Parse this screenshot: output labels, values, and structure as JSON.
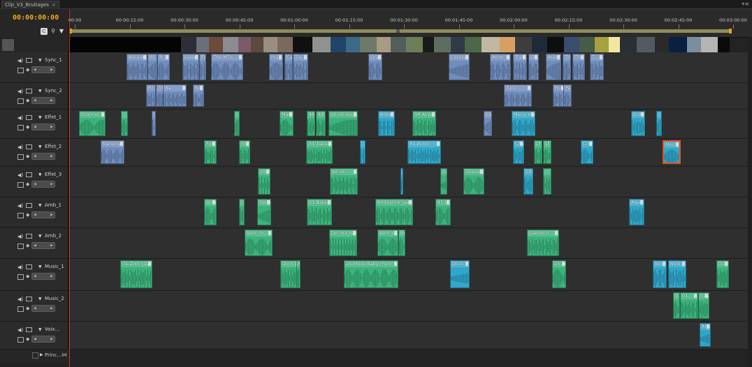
{
  "tab": {
    "title": "Clip_V3_Bruitages",
    "close": "×"
  },
  "panel_menu": "▾≡",
  "timecode": "00:00:00:00",
  "ruler": {
    "labels": [
      "00:00",
      "00:00:15:00",
      "00:00:30:00",
      "00:00:45:00",
      "00:01:00:00",
      "00:01:15:00",
      "00:01:30:00",
      "00:01:45:00",
      "00:02:00:00",
      "00:02:15:00",
      "00:02:30:00",
      "00:02:45:00",
      "00:03:00:00"
    ]
  },
  "header_icons": {
    "snap": "⊂",
    "marker": "⚲",
    "link": "▼"
  },
  "track_controls": {
    "speaker": "◀)",
    "keyframe": "◆",
    "nav_prev": "◀",
    "nav_next": "▶"
  },
  "tracks": [
    {
      "name": "Sync_1",
      "clips": [
        {
          "n": "Ascenceu",
          "c": "blue"
        },
        {
          "n": "Ri",
          "c": "blue"
        },
        {
          "n": "R",
          "c": "blue"
        },
        {
          "n": "calech",
          "c": "blue"
        },
        {
          "n": "Fe",
          "c": "blue"
        },
        {
          "n": "The.MTS",
          "c": "blue"
        },
        {
          "n": "man",
          "c": "blue"
        },
        {
          "n": "Car_p",
          "c": "blue"
        },
        {
          "n": "Tra",
          "c": "blue"
        },
        {
          "n": "Grande",
          "c": "blue"
        },
        {
          "n": "Cuisine_I",
          "c": "blue"
        },
        {
          "n": "Anim_b",
          "c": "blue"
        },
        {
          "n": "Travau",
          "c": "blue"
        },
        {
          "n": "Oi",
          "c": "blue"
        },
        {
          "n": "Arenes",
          "c": "blue"
        },
        {
          "n": "The_en",
          "c": "blue"
        },
        {
          "n": "The",
          "c": "blue"
        },
        {
          "n": "T",
          "c": "blue"
        }
      ]
    },
    {
      "name": "Sync_2",
      "clips": [
        {
          "n": "Ri",
          "c": "blue"
        },
        {
          "n": "Tiffan",
          "c": "blue"
        },
        {
          "n": "Ba",
          "c": "blue"
        },
        {
          "n": "Noria.MPC",
          "c": "blue"
        },
        {
          "n": "Tunr",
          "c": "blue"
        },
        {
          "n": "Rue",
          "c": "blue"
        },
        {
          "n": "Passage_voi",
          "c": "blue"
        }
      ]
    },
    {
      "name": "Effet_1",
      "clips": [
        {
          "n": "Scanner",
          "c": "green"
        },
        {
          "n": "",
          "c": "green"
        },
        {
          "n": "",
          "c": "blue"
        },
        {
          "n": "",
          "c": "green"
        },
        {
          "n": "Mana",
          "c": "green"
        },
        {
          "n": "48",
          "c": "green"
        },
        {
          "n": "48",
          "c": "green"
        },
        {
          "n": "Jet-ski.wa",
          "c": "green"
        },
        {
          "n": "Arbre.v",
          "c": "cyan"
        },
        {
          "n": "14-Airport",
          "c": "green"
        },
        {
          "n": "Ce",
          "c": "blue"
        },
        {
          "n": "Meca_mac",
          "c": "cyan"
        },
        {
          "n": "bulle",
          "c": "cyan"
        },
        {
          "n": "",
          "c": "cyan"
        }
      ]
    },
    {
      "name": "Effet_2",
      "clips": [
        {
          "n": "Generique",
          "c": "blue"
        },
        {
          "n": "Fonl",
          "c": "green"
        },
        {
          "n": "mc",
          "c": "green"
        },
        {
          "n": "3rt_batea",
          "c": "green"
        },
        {
          "n": "",
          "c": "cyan"
        },
        {
          "n": "41-Avion",
          "c": "cyan"
        },
        {
          "n": "Chut",
          "c": "cyan"
        },
        {
          "n": "sf",
          "c": "green"
        },
        {
          "n": "sf",
          "c": "green"
        },
        {
          "n": "Ci",
          "c": "cyan"
        },
        {
          "n": "Meca_m",
          "c": "cyan"
        }
      ]
    },
    {
      "name": "Effet_3",
      "clips": [
        {
          "n": "55-Pj",
          "c": "green"
        },
        {
          "n": "Jet-ski",
          "c": "green"
        },
        {
          "n": "",
          "c": "cyan"
        },
        {
          "n": "Co",
          "c": "green"
        },
        {
          "n": "Telesiege",
          "c": "green"
        },
        {
          "n": "Chut",
          "c": "cyan"
        },
        {
          "n": "",
          "c": "green"
        }
      ]
    },
    {
      "name": "Amb_1",
      "clips": [
        {
          "n": "amb",
          "c": "green"
        },
        {
          "n": "",
          "c": "green"
        },
        {
          "n": "Serer",
          "c": "green"
        },
        {
          "n": "51-Bateau",
          "c": "green"
        },
        {
          "n": "Ambiance_petit",
          "c": "green"
        },
        {
          "n": "45-Hé",
          "c": "green"
        },
        {
          "n": "Aqua",
          "c": "cyan"
        }
      ]
    },
    {
      "name": "Amb_2",
      "clips": [
        {
          "n": "Vent_dr",
          "c": "green"
        },
        {
          "n": "De_ma_fenel",
          "c": "green"
        },
        {
          "n": "Vent_d",
          "c": "green"
        },
        {
          "n": "Bro",
          "c": "green"
        },
        {
          "n": "Gallion.n",
          "c": "green"
        }
      ]
    },
    {
      "name": "Music_1",
      "clips": [
        {
          "n": "01-Zoot (Jazz)",
          "c": "green"
        },
        {
          "n": "Do It",
          "c": "green"
        },
        {
          "n": "Ko",
          "c": "green"
        },
        {
          "n": "25-Move Baby (Full)",
          "c": "green"
        },
        {
          "n": "Do It_m",
          "c": "cyan"
        },
        {
          "n": "25-M",
          "c": "green"
        },
        {
          "n": "Bo",
          "c": "cyan"
        },
        {
          "n": "Boib",
          "c": "cyan"
        },
        {
          "n": "01-Z",
          "c": "green"
        }
      ]
    },
    {
      "name": "Music_2",
      "clips": [
        {
          "n": "01-Zoot",
          "c": "green"
        },
        {
          "n": "01-",
          "c": "green"
        },
        {
          "n": "01-Z",
          "c": "green"
        }
      ]
    },
    {
      "name": "Voix...",
      "clips": [
        {
          "n": "Anni",
          "c": "cyan"
        }
      ]
    }
  ],
  "bottom_track": {
    "name": "Princ..."
  }
}
